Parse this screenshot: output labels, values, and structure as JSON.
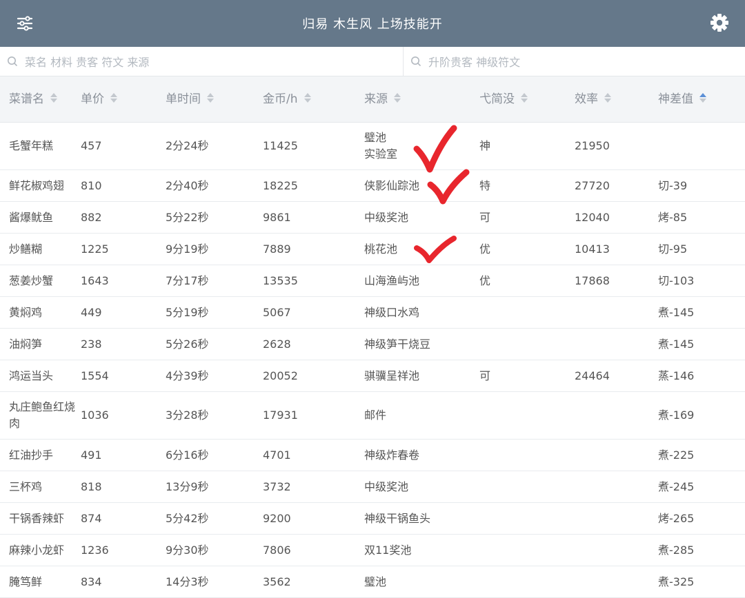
{
  "header": {
    "title": "归易 木生风 上场技能开",
    "bar_color": "#65788a",
    "menu_icon": "sliders-icon",
    "settings_icon": "gear-icon"
  },
  "search": {
    "dish_placeholder": "菜名 材料 贵客 符文 来源",
    "guest_placeholder": "升阶贵客 神级符文"
  },
  "table": {
    "columns": [
      {
        "label": "菜谱名",
        "sort": "none"
      },
      {
        "label": "单价",
        "sort": "none"
      },
      {
        "label": "单时间",
        "sort": "none"
      },
      {
        "label": "金币/h",
        "sort": "none"
      },
      {
        "label": "来源",
        "sort": "none"
      },
      {
        "label": "弋简没",
        "sort": "none"
      },
      {
        "label": "效率",
        "sort": "none"
      },
      {
        "label": "神差值",
        "sort": "ascending"
      }
    ],
    "sort_active_color": "#5b8fd6",
    "rows": [
      {
        "name": "毛蟹年糕",
        "price": "457",
        "time": "2分24秒",
        "gold": "11425",
        "source": "璧池\n实验室",
        "rank": "神",
        "eff": "21950",
        "diff": ""
      },
      {
        "name": "鲜花椒鸡翅",
        "price": "810",
        "time": "2分40秒",
        "gold": "18225",
        "source": "侠影仙踪池",
        "rank": "特",
        "eff": "27720",
        "diff": "切-39"
      },
      {
        "name": "酱爆鱿鱼",
        "price": "882",
        "time": "5分22秒",
        "gold": "9861",
        "source": "中级奖池",
        "rank": "可",
        "eff": "12040",
        "diff": "烤-85"
      },
      {
        "name": "炒鳝糊",
        "price": "1225",
        "time": "9分19秒",
        "gold": "7889",
        "source": "桃花池",
        "rank": "优",
        "eff": "10413",
        "diff": "切-95"
      },
      {
        "name": "葱姜炒蟹",
        "price": "1643",
        "time": "7分17秒",
        "gold": "13535",
        "source": "山海渔屿池",
        "rank": "优",
        "eff": "17868",
        "diff": "切-103"
      },
      {
        "name": "黄焖鸡",
        "price": "449",
        "time": "5分19秒",
        "gold": "5067",
        "source": "神级口水鸡",
        "rank": "",
        "eff": "",
        "diff": "煮-145"
      },
      {
        "name": "油焖笋",
        "price": "238",
        "time": "5分26秒",
        "gold": "2628",
        "source": "神级笋干烧豆",
        "rank": "",
        "eff": "",
        "diff": "煮-145"
      },
      {
        "name": "鸿运当头",
        "price": "1554",
        "time": "4分39秒",
        "gold": "20052",
        "source": "骐骥呈祥池",
        "rank": "可",
        "eff": "24464",
        "diff": "蒸-146"
      },
      {
        "name": "丸庄鲍鱼红烧肉",
        "price": "1036",
        "time": "3分28秒",
        "gold": "17931",
        "source": "邮件",
        "rank": "",
        "eff": "",
        "diff": "煮-169"
      },
      {
        "name": "红油抄手",
        "price": "491",
        "time": "6分16秒",
        "gold": "4701",
        "source": "神级炸春卷",
        "rank": "",
        "eff": "",
        "diff": "煮-225"
      },
      {
        "name": "三杯鸡",
        "price": "818",
        "time": "13分9秒",
        "gold": "3732",
        "source": "中级奖池",
        "rank": "",
        "eff": "",
        "diff": "煮-245"
      },
      {
        "name": "干锅香辣虾",
        "price": "874",
        "time": "5分42秒",
        "gold": "9200",
        "source": "神级干锅鱼头",
        "rank": "",
        "eff": "",
        "diff": "烤-265"
      },
      {
        "name": "麻辣小龙虾",
        "price": "1236",
        "time": "9分30秒",
        "gold": "7806",
        "source": "双11奖池",
        "rank": "",
        "eff": "",
        "diff": "煮-285"
      },
      {
        "name": "腌笃鲜",
        "price": "834",
        "time": "14分3秒",
        "gold": "3562",
        "source": "璧池",
        "rank": "",
        "eff": "",
        "diff": "煮-325"
      }
    ]
  },
  "annotations": {
    "checkmark_color": "#e8262d",
    "checkmark_icon": "red-checkmark-icon"
  }
}
